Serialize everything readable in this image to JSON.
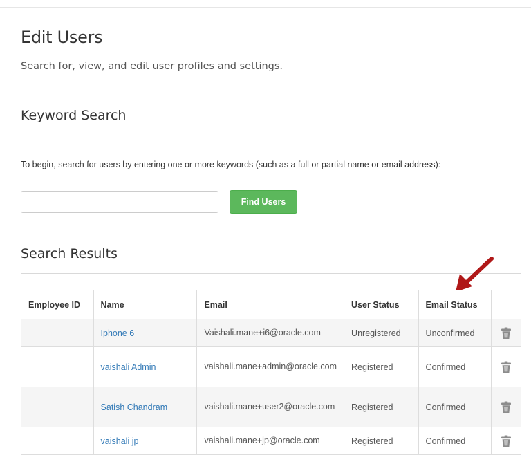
{
  "page": {
    "title": "Edit Users",
    "subtitle": "Search for, view, and edit user profiles and settings."
  },
  "keyword_search": {
    "heading": "Keyword Search",
    "instructions": "To begin, search for users by entering one or more keywords (such as a full or partial name or email address):",
    "input_value": "",
    "find_button_label": "Find Users"
  },
  "results": {
    "heading": "Search Results",
    "columns": {
      "employee_id": "Employee ID",
      "name": "Name",
      "email": "Email",
      "user_status": "User Status",
      "email_status": "Email Status"
    },
    "rows": [
      {
        "employee_id": "",
        "name": "Iphone 6",
        "email": "Vaishali.mane+i6@oracle.com",
        "user_status": "Unregistered",
        "email_status": "Unconfirmed"
      },
      {
        "employee_id": "",
        "name": "vaishali Admin",
        "email": "vaishali.mane+admin@oracle.com",
        "user_status": "Registered",
        "email_status": "Confirmed"
      },
      {
        "employee_id": "",
        "name": "Satish Chandram",
        "email": "vaishali.mane+user2@oracle.com",
        "user_status": "Registered",
        "email_status": "Confirmed"
      },
      {
        "employee_id": "",
        "name": "vaishali jp",
        "email": "vaishali.mane+jp@oracle.com",
        "user_status": "Registered",
        "email_status": "Confirmed"
      }
    ]
  },
  "icons": {
    "row_action": "trash-icon",
    "annotation": "red-arrow-icon"
  },
  "colors": {
    "primary_button": "#5cb85c",
    "link": "#337ab7",
    "annotation_arrow": "#b01818",
    "striped_row": "#f5f5f5"
  }
}
